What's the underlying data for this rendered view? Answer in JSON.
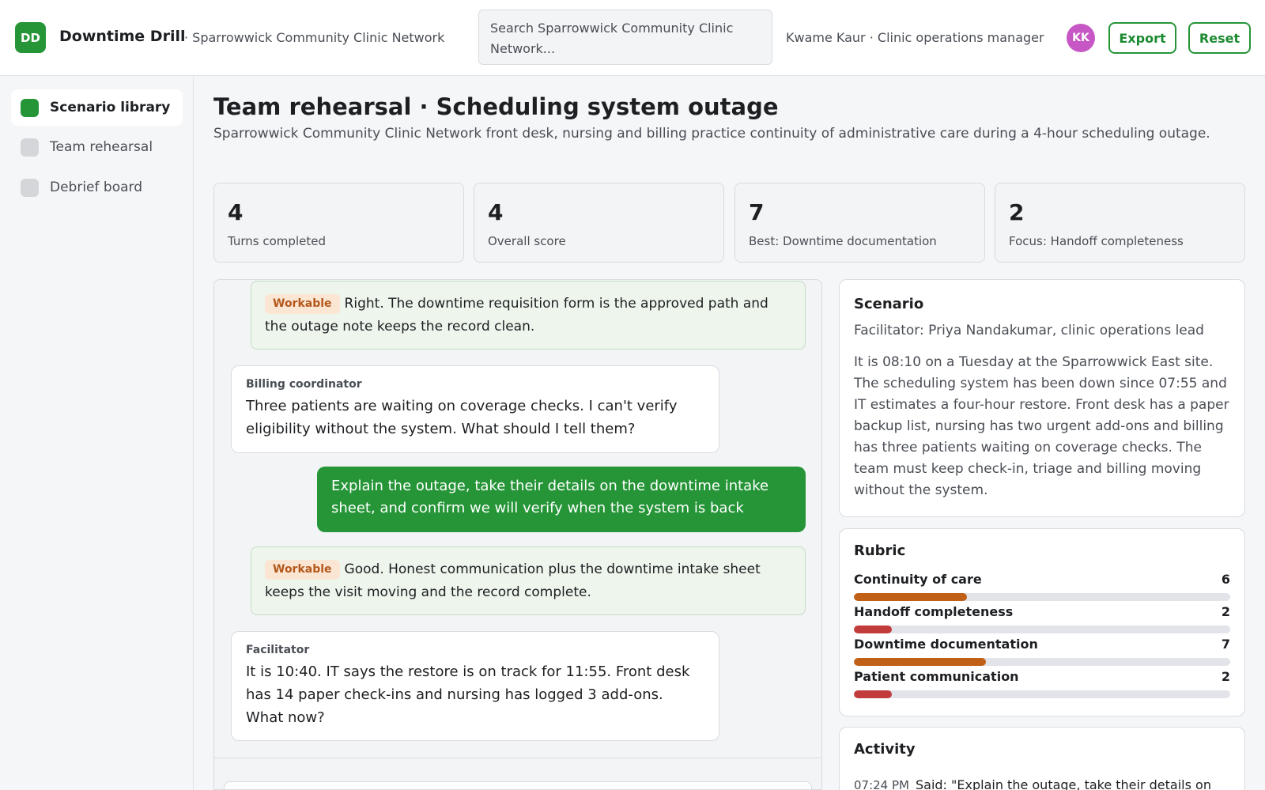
{
  "app": {
    "logo_initials": "DD",
    "title": "Downtime Drill",
    "org": "· Sparrowwick Community Clinic Network"
  },
  "search": {
    "placeholder": "Search Sparrowwick Community Clinic Network..."
  },
  "user": {
    "line": "Kwame Kaur · Clinic operations manager",
    "initials": "KK",
    "avatar_color": "#c657c5"
  },
  "actions": {
    "export": "Export",
    "reset": "Reset"
  },
  "colors": {
    "accent": "#259537",
    "bar_mid": "#c05f16",
    "bar_low": "#c33c3c"
  },
  "sidebar": {
    "items": [
      {
        "label": "Scenario library",
        "active": true
      },
      {
        "label": "Team rehearsal",
        "active": false
      },
      {
        "label": "Debrief board",
        "active": false
      }
    ]
  },
  "page": {
    "title": "Team rehearsal · Scheduling system outage",
    "subtitle": "Sparrowwick Community Clinic Network front desk, nursing and billing practice continuity of administrative care during a 4-hour scheduling outage."
  },
  "stats": [
    {
      "value": "4",
      "label": "Turns completed"
    },
    {
      "value": "4",
      "label": "Overall score"
    },
    {
      "value": "7",
      "label": "Best: Downtime documentation"
    },
    {
      "value": "2",
      "label": "Focus: Handoff completeness"
    }
  ],
  "chat": {
    "messages": [
      {
        "kind": "feedback",
        "badge": "Workable",
        "text": "Right. The downtime requisition form is the approved path and the outage note keeps the record clean."
      },
      {
        "kind": "incoming",
        "who": "Billing coordinator",
        "text": "Three patients are waiting on coverage checks. I can't verify eligibility without the system. What should I tell them?"
      },
      {
        "kind": "outgoing",
        "text": "Explain the outage, take their details on the downtime intake sheet, and confirm we will verify when the system is back"
      },
      {
        "kind": "feedback",
        "badge": "Workable",
        "text": "Good. Honest communication plus the downtime intake sheet keeps the visit moving and the record complete."
      },
      {
        "kind": "incoming",
        "who": "Facilitator",
        "text": "It is 10:40. IT says the restore is on track for 11:55. Front desk has 14 paper check-ins and nursing has logged 3 add-ons. What now?"
      }
    ]
  },
  "scenario": {
    "title": "Scenario",
    "facilitator": "Facilitator: Priya Nandakumar, clinic operations lead",
    "body": "It is 08:10 on a Tuesday at the Sparrowwick East site. The scheduling system has been down since 07:55 and IT estimates a four-hour restore. Front desk has a paper backup list, nursing has two urgent add-ons and billing has three patients waiting on coverage checks. The team must keep check-in, triage and billing moving without the system."
  },
  "rubric": {
    "title": "Rubric",
    "max": 20,
    "items": [
      {
        "label": "Continuity of care",
        "value": 6
      },
      {
        "label": "Handoff completeness",
        "value": 2
      },
      {
        "label": "Downtime documentation",
        "value": 7
      },
      {
        "label": "Patient communication",
        "value": 2
      }
    ]
  },
  "activity": {
    "title": "Activity",
    "entries": [
      {
        "time": "07:24 PM",
        "text": "Said: \"Explain the outage, take their details on"
      }
    ]
  }
}
